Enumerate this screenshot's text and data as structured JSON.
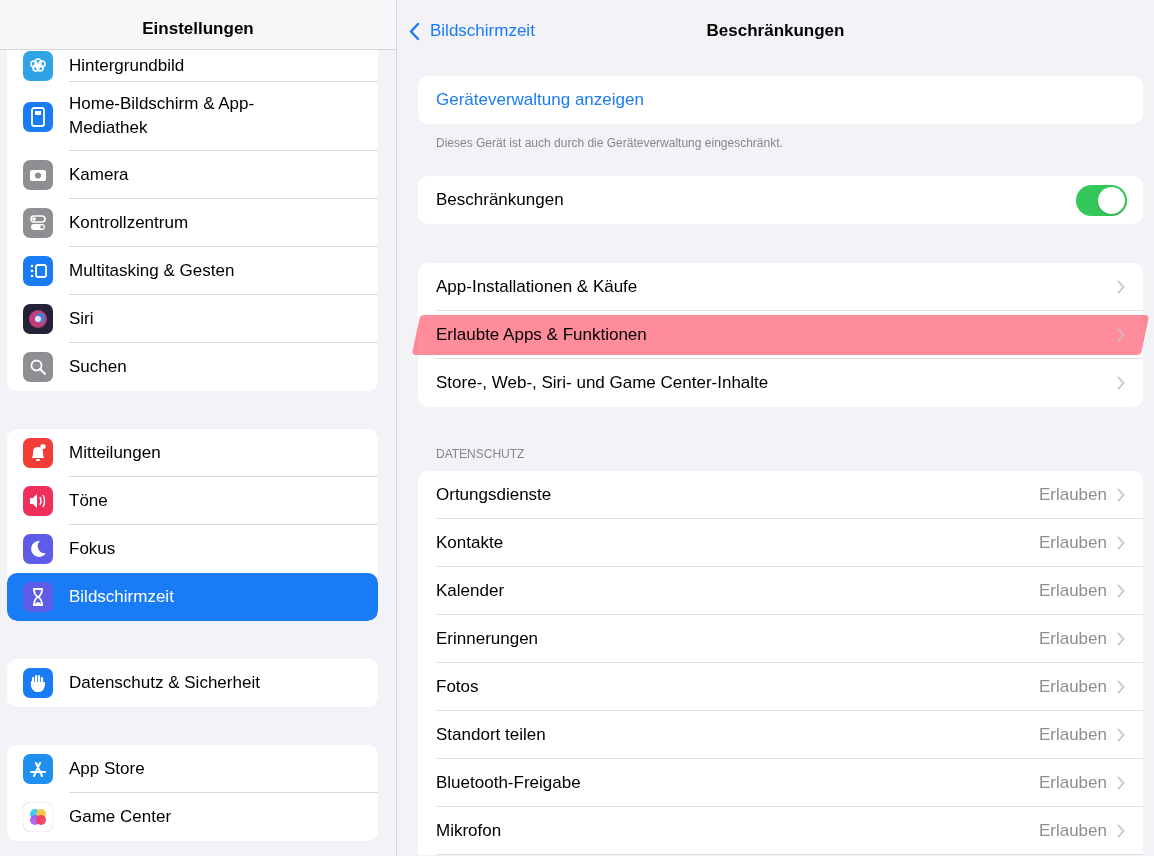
{
  "sidebar": {
    "title": "Einstellungen",
    "groups": [
      {
        "items": [
          {
            "label": "Hintergrundbild",
            "kind": "wallpaper",
            "selected": false
          },
          {
            "label": "Home-Bildschirm & App-Mediathek",
            "kind": "homescreen",
            "selected": false
          },
          {
            "label": "Kamera",
            "kind": "camera",
            "selected": false
          },
          {
            "label": "Kontrollzentrum",
            "kind": "switches",
            "selected": false
          },
          {
            "label": "Multitasking & Gesten",
            "kind": "multitasking",
            "selected": false
          },
          {
            "label": "Siri",
            "kind": "siri",
            "selected": false
          },
          {
            "label": "Suchen",
            "kind": "search",
            "selected": false
          }
        ]
      },
      {
        "items": [
          {
            "label": "Mitteilungen",
            "kind": "bell",
            "selected": false
          },
          {
            "label": "Töne",
            "kind": "speaker",
            "selected": false
          },
          {
            "label": "Fokus",
            "kind": "moon",
            "selected": false
          },
          {
            "label": "Bildschirmzeit",
            "kind": "hourglass",
            "selected": true
          }
        ]
      },
      {
        "items": [
          {
            "label": "Datenschutz & Sicherheit",
            "kind": "hand",
            "selected": false
          }
        ]
      },
      {
        "items": [
          {
            "label": "App Store",
            "kind": "appstore",
            "selected": false
          },
          {
            "label": "Game Center",
            "kind": "gamecenter",
            "selected": false
          }
        ]
      }
    ]
  },
  "detail": {
    "back": "Bildschirmzeit",
    "title": "Beschränkungen",
    "management_link": "Geräteverwaltung anzeigen",
    "management_note": "Dieses Gerät ist auch durch die Geräteverwaltung eingeschränkt.",
    "restrictions_toggle": {
      "label": "Beschränkungen",
      "on": true
    },
    "menu": [
      {
        "label": "App-Installationen & Käufe",
        "highlighted": false
      },
      {
        "label": "Erlaubte Apps & Funktionen",
        "highlighted": true
      },
      {
        "label": "Store-, Web-, Siri- und Game Center-Inhalte",
        "highlighted": false
      }
    ],
    "privacy": {
      "header": "DATENSCHUTZ",
      "rows": [
        {
          "label": "Ortungsdienste",
          "value": "Erlauben"
        },
        {
          "label": "Kontakte",
          "value": "Erlauben"
        },
        {
          "label": "Kalender",
          "value": "Erlauben"
        },
        {
          "label": "Erinnerungen",
          "value": "Erlauben"
        },
        {
          "label": "Fotos",
          "value": "Erlauben"
        },
        {
          "label": "Standort teilen",
          "value": "Erlauben"
        },
        {
          "label": "Bluetooth-Freigabe",
          "value": "Erlauben"
        },
        {
          "label": "Mikrofon",
          "value": "Erlauben"
        }
      ]
    }
  }
}
